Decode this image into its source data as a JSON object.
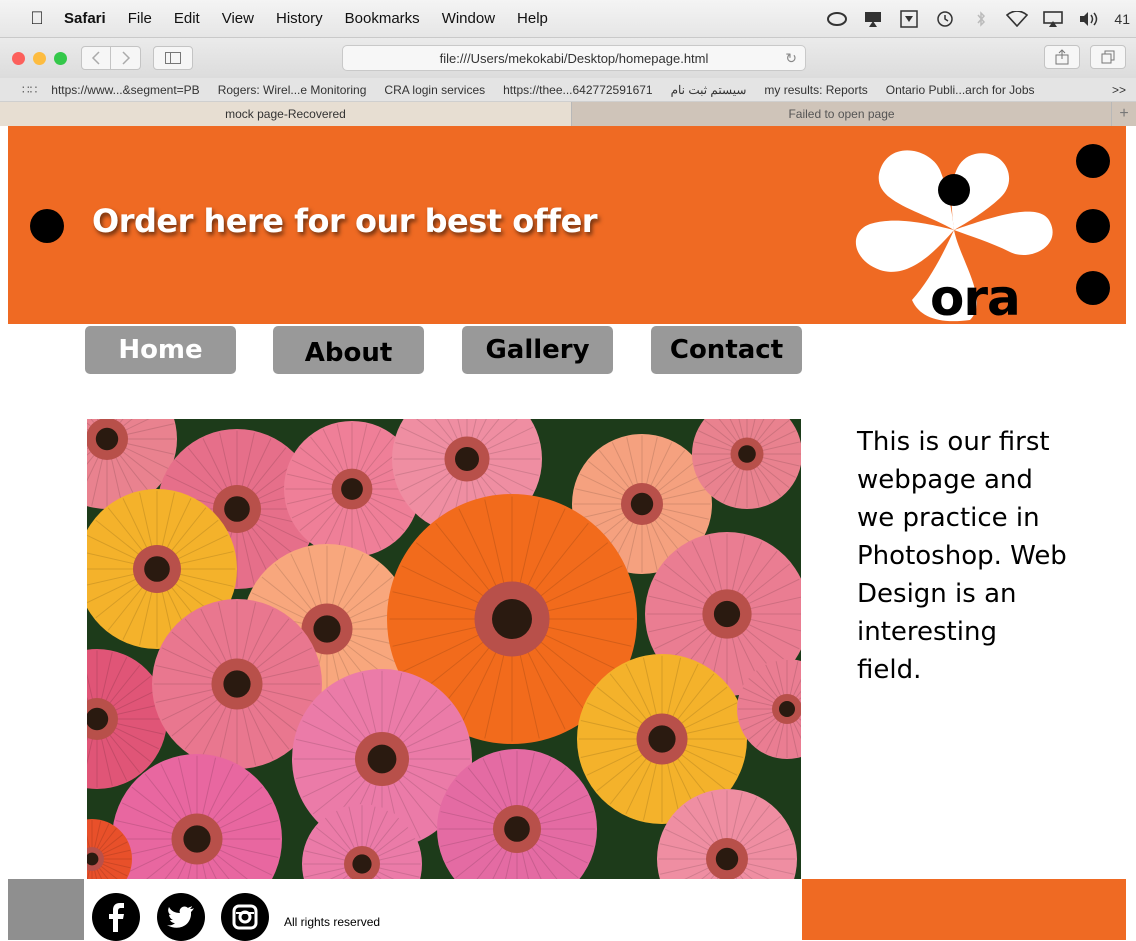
{
  "menubar": {
    "app": "Safari",
    "items": [
      "File",
      "Edit",
      "View",
      "History",
      "Bookmarks",
      "Window",
      "Help"
    ],
    "status_partial": "41"
  },
  "toolbar": {
    "url": "file:///Users/mekokabi/Desktop/homepage.html"
  },
  "bookmarks": {
    "items": [
      "https://www...&segment=PB",
      "Rogers: Wirel...e Monitoring",
      "CRA login services",
      "https://thee...642772591671",
      "سیستم ثبت نام",
      "my results: Reports",
      "Ontario Publi...arch for Jobs"
    ],
    "more": ">>"
  },
  "tabs": {
    "active": "mock page-Recovered",
    "inactive": "Failed to open page",
    "add": "+"
  },
  "site": {
    "headline": "Order here for our best offer",
    "logo_text": "ora",
    "nav": [
      "Home",
      "About",
      "Gallery",
      "Contact"
    ],
    "side_text": "This is our first webpage  and we practice in Photoshop. Web Design is an interesting field.",
    "footer_text": "All rights reserved",
    "brand_color": "#ef6a23",
    "button_color": "#999999"
  }
}
